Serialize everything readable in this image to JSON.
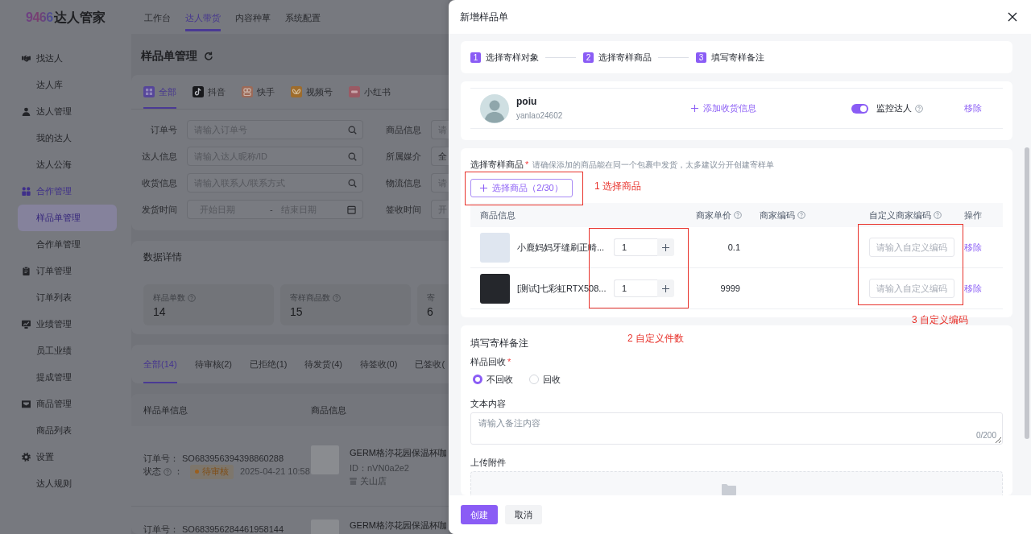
{
  "app": {
    "logo": {
      "number": "9466",
      "name": "达人管家"
    },
    "top_nav": [
      {
        "label": "工作台",
        "selected": false
      },
      {
        "label": "达人带货",
        "selected": true
      },
      {
        "label": "内容种草",
        "selected": false
      },
      {
        "label": "系统配置",
        "selected": false
      }
    ],
    "sidebar": [
      {
        "label": "找达人",
        "selected": false,
        "children": [
          {
            "label": "达人库",
            "selected": false
          }
        ]
      },
      {
        "label": "达人管理",
        "selected": false,
        "children": [
          {
            "label": "我的达人",
            "selected": false
          },
          {
            "label": "达人公海",
            "selected": false
          }
        ]
      },
      {
        "label": "合作管理",
        "selected": true,
        "children": [
          {
            "label": "样品单管理",
            "selected": true
          },
          {
            "label": "合作单管理",
            "selected": false
          }
        ]
      },
      {
        "label": "订单管理",
        "selected": false,
        "children": [
          {
            "label": "订单列表",
            "selected": false
          }
        ]
      },
      {
        "label": "业绩管理",
        "selected": false,
        "children": [
          {
            "label": "员工业绩",
            "selected": false
          },
          {
            "label": "提成管理",
            "selected": false
          }
        ]
      },
      {
        "label": "商品管理",
        "selected": false,
        "children": [
          {
            "label": "商品列表",
            "selected": false
          }
        ]
      },
      {
        "label": "设置",
        "selected": false,
        "children": [
          {
            "label": "达人规则",
            "selected": false
          }
        ]
      }
    ],
    "page_title": "样品单管理",
    "platform_tabs": [
      {
        "label": "全部",
        "selected": true
      },
      {
        "label": "抖音",
        "selected": false
      },
      {
        "label": "快手",
        "selected": false
      },
      {
        "label": "视频号",
        "selected": false
      },
      {
        "label": "小红书",
        "selected": false
      }
    ],
    "filters": [
      {
        "label": "订单号",
        "kind": "search",
        "placeholder": "请输入订单号"
      },
      {
        "label": "商品信息",
        "kind": "text",
        "placeholder": "请"
      },
      {
        "label": "达人信息",
        "kind": "search",
        "placeholder": "请输入达人昵称/ID"
      },
      {
        "label": "所属媒介",
        "kind": "text",
        "value": "全"
      },
      {
        "label": "收货信息",
        "kind": "search",
        "placeholder": "请输入联系人/联系方式"
      },
      {
        "label": "物流信息",
        "kind": "text",
        "placeholder": "请"
      },
      {
        "label": "发货时间",
        "kind": "date_range",
        "start_placeholder": "开始日期",
        "separator": "-",
        "end_placeholder": "结束日期"
      },
      {
        "label": "签收时间",
        "kind": "text",
        "placeholder": "开"
      }
    ],
    "stats_title": "数据详情",
    "stats": [
      {
        "label": "样品单数",
        "help": true,
        "value": "14"
      },
      {
        "label": "寄样商品数",
        "help": true,
        "value": "15"
      },
      {
        "label": "寄",
        "help": false,
        "value": "6"
      }
    ],
    "status_tabs": [
      {
        "label": "全部(14)",
        "selected": true
      },
      {
        "label": "待审核(2)",
        "selected": false
      },
      {
        "label": "已拒绝(1)",
        "selected": false
      },
      {
        "label": "待发货(4)",
        "selected": false
      },
      {
        "label": "待签收(0)",
        "selected": false
      },
      {
        "label": "已签收(",
        "selected": false
      }
    ],
    "table": {
      "columns": [
        "样品单信息",
        "商品信息"
      ],
      "rows": [
        {
          "order_label": "订单号：",
          "order_no": "SO683956394398860288",
          "status_label": "状态",
          "status_colon": "：",
          "status": "待审核",
          "time": "2025-04-21 10:58",
          "product": {
            "title": "GERM格沵花园保温杯咖",
            "id": "ID：nVN0a2e2",
            "store": "关山店"
          }
        },
        {
          "order_label": "订单号：",
          "order_no": "SO683956284461958144",
          "product": {
            "title": "GERM格沵花园保温杯咖"
          }
        }
      ]
    }
  },
  "drawer": {
    "title": "新增样品单",
    "steps": [
      {
        "number": "1",
        "label": "选择寄样对象"
      },
      {
        "number": "2",
        "label": "选择寄样商品"
      },
      {
        "number": "3",
        "label": "填写寄样备注"
      }
    ],
    "creator": {
      "name": "poiu",
      "handle": "yanlao24602",
      "add_address": "添加收货信息",
      "monitor_label": "监控达人",
      "monitor_on": true,
      "remove": "移除"
    },
    "products": {
      "title": "选择寄样商品",
      "required_mark": "*",
      "hint": "请确保添加的商品能在同一个包裹中发货，太多建议分开创建寄样单",
      "select_button": "选择商品（2/30）",
      "columns": [
        {
          "label": "商品信息",
          "help": false
        },
        {
          "label": "商家单价",
          "help": true
        },
        {
          "label": "商家编码",
          "help": true
        },
        {
          "label": "自定义商家编码",
          "help": true
        },
        {
          "label": "操作",
          "help": false
        }
      ],
      "rows": [
        {
          "title": "小鹿妈妈牙缝刷正畸...",
          "quantity": "1",
          "price": "0.1",
          "code_placeholder": "请输入自定义编码",
          "action": "移除"
        },
        {
          "title": "[测试]七彩虹RTX508...",
          "quantity": "1",
          "price": "9999",
          "code_placeholder": "请输入自定义编码",
          "action": "移除"
        }
      ]
    },
    "annotations": [
      {
        "text": "1 选择商品"
      },
      {
        "text": "2 自定义件数"
      },
      {
        "text": "3 自定义编码"
      }
    ],
    "remarks": {
      "title": "填写寄样备注",
      "recycle_label": "样品回收",
      "required_mark": "*",
      "recycle_options": [
        {
          "label": "不回收",
          "selected": true
        },
        {
          "label": "回收",
          "selected": false
        }
      ],
      "text_label": "文本内容",
      "text_placeholder": "请输入备注内容",
      "counter": "0/200",
      "upload_label": "上传附件"
    },
    "buttons": [
      {
        "label": "创建",
        "kind": "primary"
      },
      {
        "label": "取消",
        "kind": "secondary"
      }
    ]
  }
}
